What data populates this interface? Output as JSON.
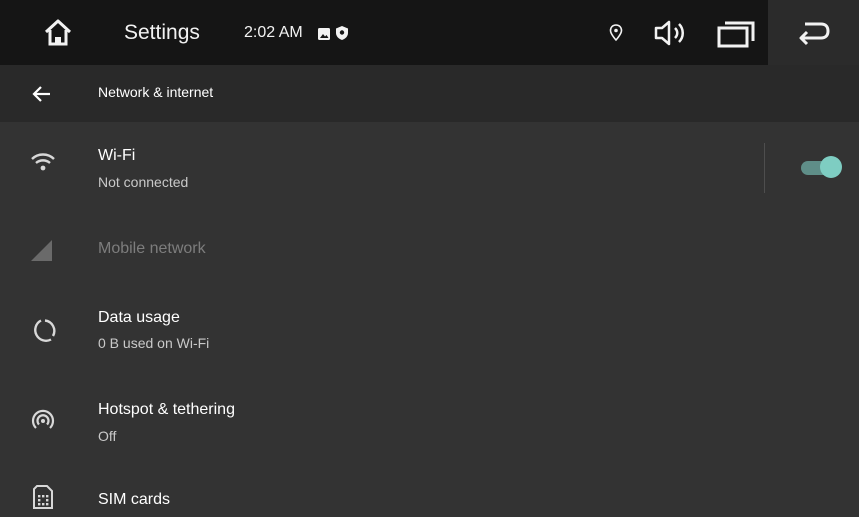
{
  "status_bar": {
    "app_title": "Settings",
    "time": "2:02 AM",
    "icons": [
      "home-icon",
      "image-notification-icon",
      "shield-notification-icon",
      "location-icon",
      "volume-icon",
      "recents-icon",
      "back-icon"
    ]
  },
  "header": {
    "title": "Network & internet"
  },
  "settings": {
    "items": [
      {
        "title": "Wi-Fi",
        "summary": "Not connected",
        "icon": "wifi-icon",
        "toggle_on": true
      },
      {
        "title": "Mobile network",
        "summary": "",
        "icon": "cellular-signal-icon",
        "disabled": true
      },
      {
        "title": "Data usage",
        "summary": "0 B used on Wi-Fi",
        "icon": "data-usage-icon"
      },
      {
        "title": "Hotspot & tethering",
        "summary": "Off",
        "icon": "hotspot-icon"
      },
      {
        "title": "SIM cards",
        "summary": "",
        "icon": "sim-card-icon"
      }
    ]
  },
  "colors": {
    "background": "#333333",
    "status_bar": "#151515",
    "app_bar": "#292929",
    "accent": "#7ecdc2"
  }
}
